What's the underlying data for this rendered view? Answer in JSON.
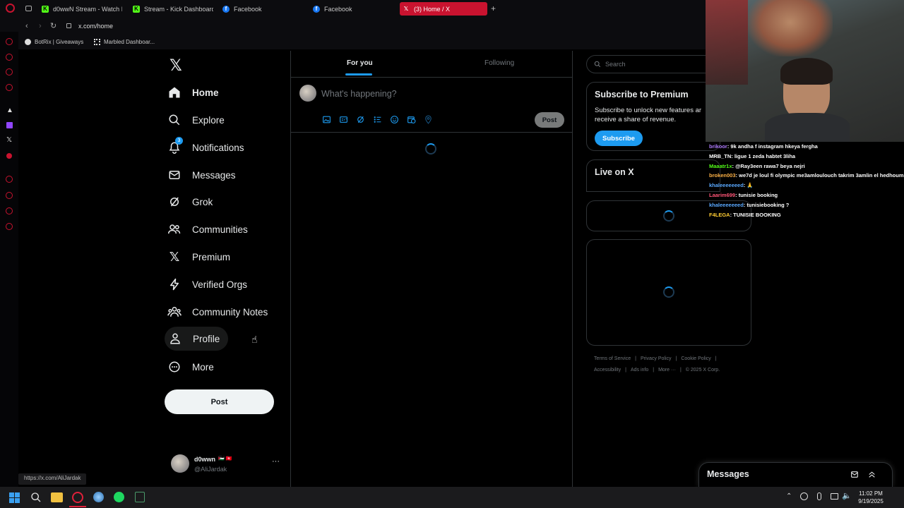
{
  "browser": {
    "tabs": [
      {
        "label": "d0wwN Stream - Watch L",
        "icon": "kick-icon",
        "color": "#53fc18"
      },
      {
        "label": "Stream - Kick Dashboard",
        "icon": "kick-icon",
        "color": "#53fc18"
      },
      {
        "label": "Facebook",
        "icon": "facebook-icon",
        "color": "#1877f2"
      },
      {
        "label": "Facebook",
        "icon": "facebook-icon",
        "color": "#1877f2"
      },
      {
        "label": "(3) Home / X",
        "icon": "x-icon",
        "color": "#c9132f",
        "active": true
      }
    ],
    "new_tab": "+",
    "url": "x.com/home",
    "bookmarks": [
      {
        "label": "BotRix | Giveaways",
        "icon": "botrix-icon"
      },
      {
        "label": "Marbled Dashboar...",
        "icon": "grid-icon"
      }
    ],
    "status_url": "https://x.com/AliJardak"
  },
  "nav": {
    "logo": "x-logo",
    "items": [
      {
        "label": "Home",
        "icon": "home-icon",
        "bold": true
      },
      {
        "label": "Explore",
        "icon": "search-icon"
      },
      {
        "label": "Notifications",
        "icon": "bell-icon",
        "badge": "3"
      },
      {
        "label": "Messages",
        "icon": "envelope-icon"
      },
      {
        "label": "Grok",
        "icon": "grok-icon"
      },
      {
        "label": "Communities",
        "icon": "people-icon"
      },
      {
        "label": "Premium",
        "icon": "x-icon"
      },
      {
        "label": "Verified Orgs",
        "icon": "lightning-icon"
      },
      {
        "label": "Community Notes",
        "icon": "community-notes-icon"
      },
      {
        "label": "Profile",
        "icon": "person-icon"
      },
      {
        "label": "More",
        "icon": "more-circle-icon"
      }
    ],
    "post_label": "Post",
    "account": {
      "name": "d0wwn",
      "flags": "🇵🇸 🇹🇳",
      "handle": "@AliJardak",
      "more": "···"
    }
  },
  "feed": {
    "tabs": [
      {
        "label": "For you",
        "active": true
      },
      {
        "label": "Following"
      }
    ],
    "composer_placeholder": "What's happening?",
    "composer_icons": [
      "image-icon",
      "gif-icon",
      "grok-icon",
      "poll-icon",
      "emoji-icon",
      "schedule-icon",
      "location-icon"
    ],
    "post_label": "Post"
  },
  "right": {
    "search_placeholder": "Search",
    "premium": {
      "title": "Subscribe to Premium",
      "body": "Subscribe to unlock new features ar receive a share of revenue.",
      "button": "Subscribe"
    },
    "live_title": "Live on X",
    "footer": [
      "Terms of Service",
      "Privacy Policy",
      "Cookie Policy",
      "Accessibility",
      "Ads info",
      "More ···",
      "© 2025 X Corp."
    ]
  },
  "chat": [
    {
      "user": "brikoor",
      "color": "#b07cff",
      "text": ": 9k andha f instagram hkeya fergha"
    },
    {
      "user": "MRB_TN",
      "color": "#ffffff",
      "text": ": ligue 1 zeda habtet 3liha"
    },
    {
      "user": "Maaatr1x",
      "color": "#53fc18",
      "text": ": @Ray3een rawa7 beya nejri"
    },
    {
      "user": "broken003",
      "color": "#ffb347",
      "text": ": we7d je loul fi olympic me3amloulouch takrim 3amlin el hedhoum"
    },
    {
      "user": "khaleeeeeeed",
      "color": "#5aa9ff",
      "text": ": 🙏"
    },
    {
      "user": "Laarim699",
      "color": "#ff5577",
      "text": ": tunisie booking"
    },
    {
      "user": "khaleeeeeeed",
      "color": "#5aa9ff",
      "text": ": tunisiebooking ?"
    },
    {
      "user": "F4LEGA",
      "color": "#ffcc33",
      "text": ": TUNISIE BOOKING"
    }
  ],
  "messages_drawer": {
    "title": "Messages"
  },
  "taskbar": {
    "time": "11:02 PM",
    "date": "9/19/2025"
  }
}
